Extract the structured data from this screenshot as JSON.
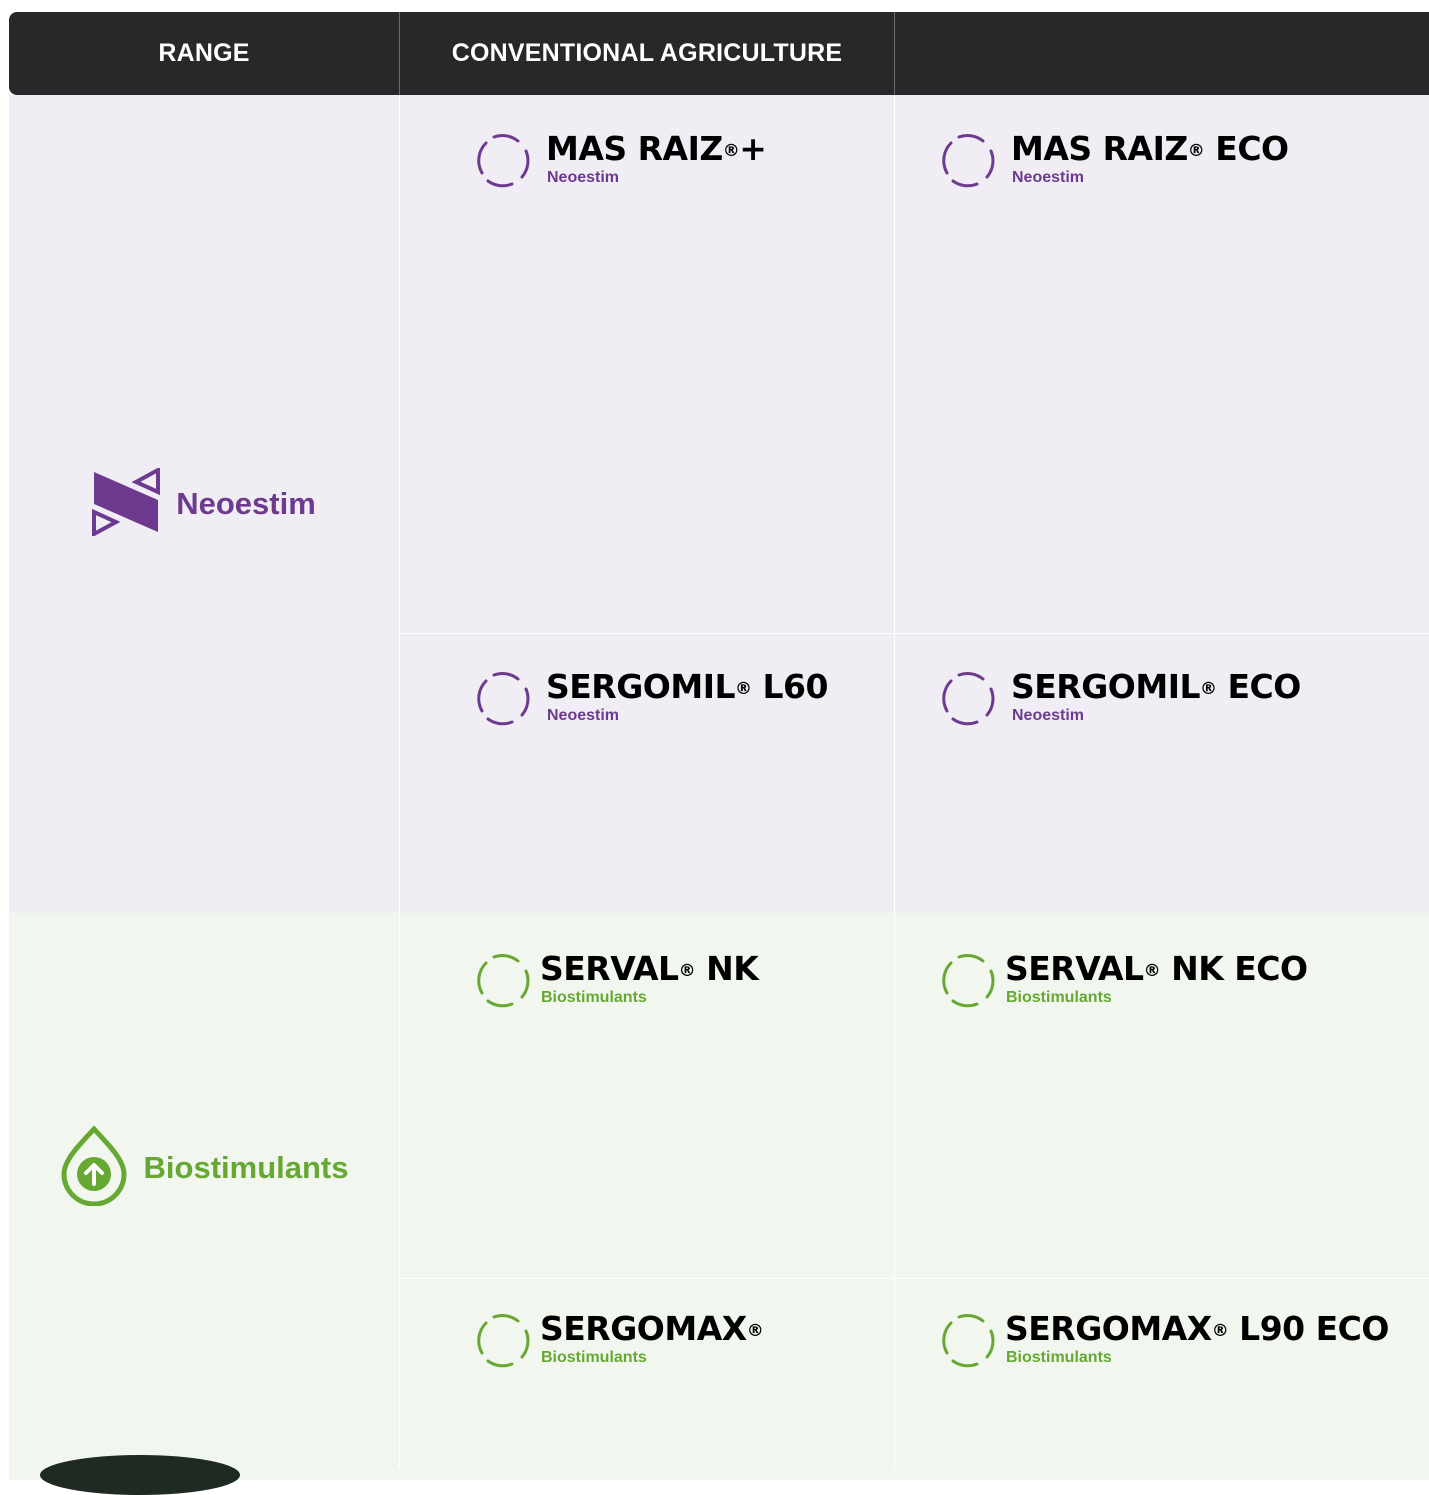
{
  "header": {
    "col1": "RANGE",
    "col2": "CONVENTIONAL AGRICULTURE",
    "col3": ""
  },
  "colors": {
    "header_bg": "#28282a",
    "neoestim": "#6d3a8f",
    "biostimulants": "#66a832",
    "neoestim_band": "#f0edf5",
    "biostimulants_band": "#f1f6ee"
  },
  "ranges": [
    {
      "name": "Neoestim",
      "icon": "neoestim-logo-icon"
    },
    {
      "name": "Biostimulants",
      "icon": "biostimulants-drop-arrow-icon"
    }
  ],
  "products": {
    "mas_raiz_plus": {
      "name": "MAS RAIZ",
      "mark": "®",
      "suffix": "+",
      "category": "Neoestim",
      "icon": "ring-icon"
    },
    "mas_raiz_eco": {
      "name": "MAS RAIZ",
      "mark": "®",
      "suffix": " ECO",
      "category": "Neoestim",
      "icon": "ring-icon"
    },
    "sergomil_l60": {
      "name": "SERGOMIL",
      "mark": "®",
      "suffix": " L60",
      "category": "Neoestim",
      "icon": "ring-icon"
    },
    "sergomil_eco": {
      "name": "SERGOMIL",
      "mark": "®",
      "suffix": " ECO",
      "category": "Neoestim",
      "icon": "ring-icon"
    },
    "serval_nk": {
      "name": "SERVAL",
      "mark": "®",
      "suffix": " NK",
      "category": "Biostimulants",
      "icon": "ring-icon"
    },
    "serval_nk_eco": {
      "name": "SERVAL",
      "mark": "®",
      "suffix": " NK ECO",
      "category": "Biostimulants",
      "icon": "ring-icon"
    },
    "sergomax": {
      "name": "SERGOMAX",
      "mark": "®",
      "suffix": "",
      "category": "Biostimulants",
      "icon": "ring-icon"
    },
    "sergomax_l90_eco": {
      "name": "SERGOMAX",
      "mark": "®",
      "suffix": " L90 ECO",
      "category": "Biostimulants",
      "icon": "ring-icon"
    }
  }
}
